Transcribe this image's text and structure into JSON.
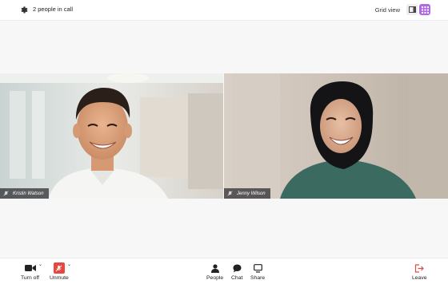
{
  "header": {
    "participants_text": "2 people in call",
    "view_label": "Grid view"
  },
  "participants": [
    {
      "name": "Kristin Watson",
      "mic_muted": true
    },
    {
      "name": "Jenny Wilson",
      "mic_muted": true
    }
  ],
  "toolbar": {
    "camera_label": "Turn off",
    "mic_label": "Unmute",
    "people_label": "People",
    "chat_label": "Chat",
    "share_label": "Share",
    "leave_label": "Leave"
  },
  "colors": {
    "accent": "#b06ae6",
    "mute_red": "#e8473f",
    "leave_red": "#e24a43"
  },
  "icons": [
    "gear-icon",
    "sidebar-view-icon",
    "grid-view-icon",
    "mic-off-icon",
    "video-camera-icon",
    "person-icon",
    "chat-bubble-icon",
    "share-screen-icon",
    "leave-icon"
  ]
}
